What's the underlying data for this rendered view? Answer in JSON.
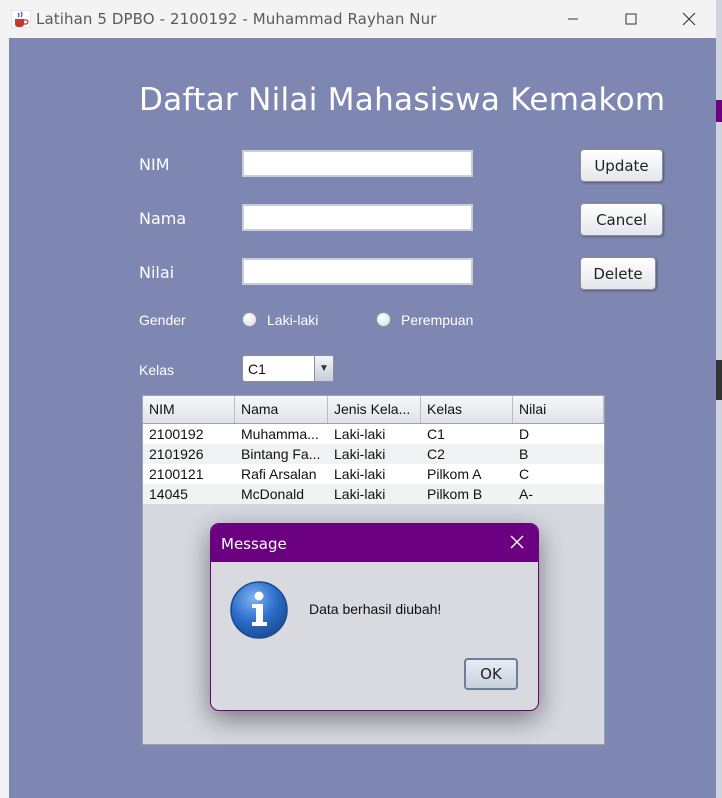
{
  "window": {
    "title": "Latihan 5 DPBO - 2100192 - Muhammad Rayhan Nur",
    "icon": "java-coffee-icon"
  },
  "form": {
    "heading": "Daftar Nilai Mahasiswa Kemakom",
    "nim_label": "NIM",
    "nama_label": "Nama",
    "nilai_label": "Nilai",
    "gender_label": "Gender",
    "kelas_label": "Kelas",
    "nim_value": "",
    "nama_value": "",
    "nilai_value": "",
    "gender_options": [
      "Laki-laki",
      "Perempuan"
    ],
    "kelas_selected": "C1"
  },
  "buttons": {
    "update": "Update",
    "cancel": "Cancel",
    "delete": "Delete"
  },
  "table": {
    "columns": [
      "NIM",
      "Nama",
      "Jenis Kela...",
      "Kelas",
      "Nilai"
    ],
    "rows": [
      [
        "2100192",
        "Muhamma...",
        "Laki-laki",
        "C1",
        "D"
      ],
      [
        "2101926",
        "Bintang Fa...",
        "Laki-laki",
        "C2",
        "B"
      ],
      [
        "2100121",
        "Rafi Arsalan",
        "Laki-laki",
        "Pilkom A",
        "C"
      ],
      [
        "14045",
        "McDonald",
        "Laki-laki",
        "Pilkom B",
        "A-"
      ]
    ]
  },
  "dialog": {
    "title": "Message",
    "message": "Data berhasil diubah!",
    "ok": "OK",
    "icon": "information-icon"
  },
  "colors": {
    "background": "#7e87b2",
    "dialog_titlebar": "#6b0080"
  }
}
